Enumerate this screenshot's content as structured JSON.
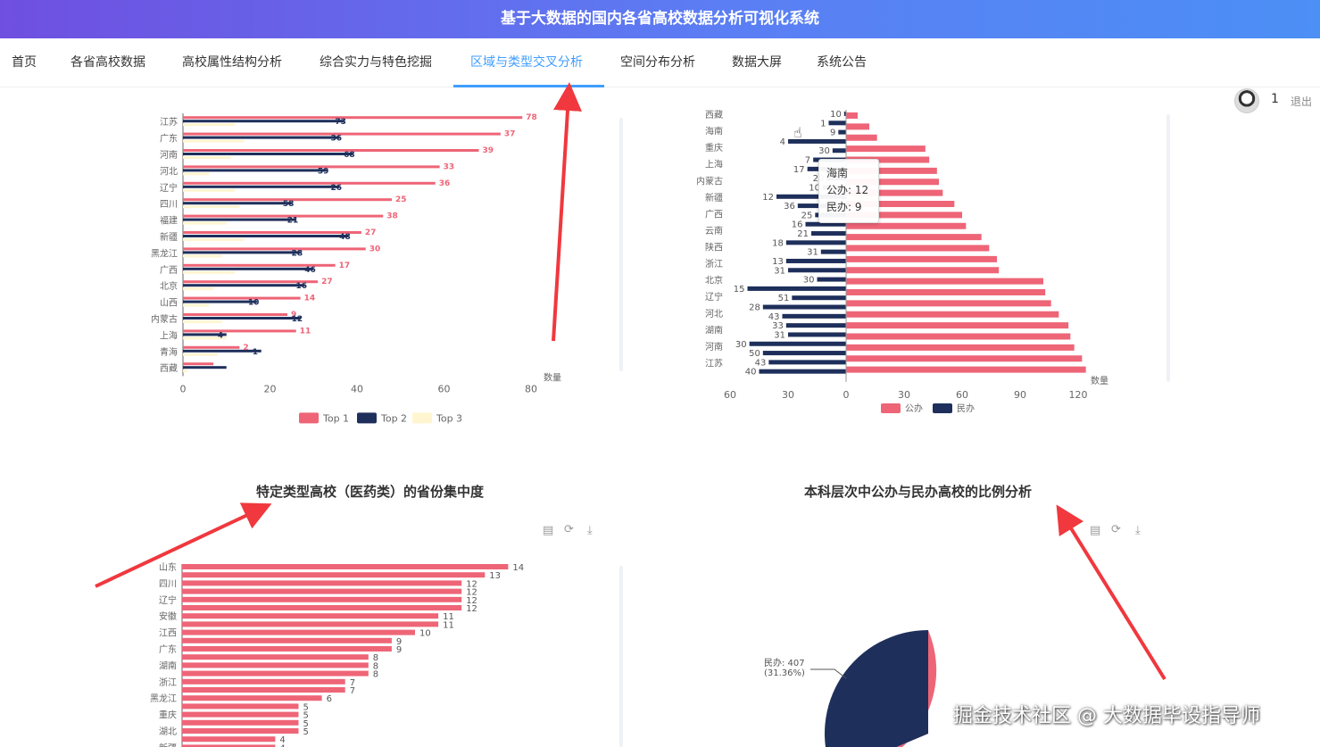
{
  "app": {
    "title": "基于大数据的国内各省高校数据分析可视化系统"
  },
  "nav": {
    "items": [
      "首页",
      "各省高校数据",
      "高校属性结构分析",
      "综合实力与特色挖掘",
      "区域与类型交叉分析",
      "空间分布分析",
      "数据大屏",
      "系统公告"
    ],
    "active_index": 4,
    "user_name": "1",
    "logout_label": "退出"
  },
  "panels": {
    "bottom_left_title": "特定类型高校（医药类）的省份集中度",
    "bottom_right_title": "本科层次中公办与民办高校的比例分析"
  },
  "tooltip": {
    "title": "海南",
    "line1": "公办: 12",
    "line2": "民办: 9"
  },
  "watermark": "掘金技术社区 @ 大数据毕设指导师",
  "colors": {
    "accent": "#409eff",
    "pink": "#ee6577",
    "navy": "#1e2f5b",
    "cream": "#fff5d0"
  },
  "chart_data": [
    {
      "type": "bar",
      "orientation": "horizontal",
      "categories": [
        "江苏",
        "广东",
        "河南",
        "河北",
        "辽宁",
        "四川",
        "福建",
        "新疆",
        "黑龙江",
        "广西",
        "北京",
        "山西",
        "内蒙古",
        "上海",
        "青海",
        "西藏"
      ],
      "series": [
        {
          "name": "Top 1",
          "values": [
            78,
            73,
            68,
            59,
            58,
            48,
            46,
            41,
            42,
            35,
            31,
            27,
            24,
            26,
            13,
            7
          ]
        },
        {
          "name": "Top 2",
          "values": [
            37,
            36,
            39,
            33,
            36,
            25,
            26,
            38,
            27,
            30,
            28,
            17,
            27,
            10,
            18,
            10
          ]
        },
        {
          "name": "Top 3",
          "values": [
            12,
            14,
            11,
            6,
            12,
            13,
            10,
            14,
            9,
            12,
            7,
            6,
            9,
            10,
            8,
            1
          ]
        }
      ],
      "value_labels": [
        "78",
        "73",
        "37",
        "36",
        "39",
        "68",
        "33",
        "59",
        "36",
        "26",
        "25",
        "58",
        "38",
        "21",
        "27",
        "48",
        "30",
        "28",
        "17",
        "46",
        "27",
        "16",
        "14",
        "10",
        "9",
        "12",
        "11",
        "4",
        "2",
        "1"
      ],
      "xlabel": "数量",
      "xticks": [
        "0",
        "20",
        "40",
        "60",
        "80"
      ],
      "xlim": [
        0,
        80
      ],
      "legend": [
        "Top 1",
        "Top 2",
        "Top 3"
      ],
      "legend_position": "bottom"
    },
    {
      "type": "bar",
      "orientation": "horizontal",
      "categories": [
        "西藏",
        "海南",
        "重庆",
        "上海",
        "内蒙古",
        "新疆",
        "广西",
        "云南",
        "陕西",
        "浙江",
        "北京",
        "辽宁",
        "河北",
        "湖南",
        "河南",
        "江苏"
      ],
      "series": [
        {
          "name": "公办",
          "values": [
            6,
            12,
            16,
            41,
            43,
            47,
            48,
            50,
            56,
            60,
            62,
            70,
            74,
            78,
            79,
            102,
            103,
            106,
            110,
            115,
            116,
            118,
            122,
            124
          ]
        },
        {
          "name": "民办",
          "values": [
            1,
            9,
            4,
            30,
            7,
            17,
            20,
            10,
            12,
            36,
            25,
            16,
            21,
            18,
            31,
            13,
            31,
            30,
            15,
            51,
            28,
            43,
            33,
            31,
            30,
            50,
            43,
            40,
            45
          ]
        }
      ],
      "series_value_labels": [
        "10",
        "1",
        "9",
        "4",
        "30",
        "7",
        "17",
        "20",
        "10",
        "12",
        "36",
        "25",
        "16",
        "21",
        "18",
        "31",
        "13",
        "31",
        "30",
        "15",
        "51",
        "28",
        "43",
        "33",
        "31",
        "30",
        "50",
        "43",
        "40",
        "45"
      ],
      "xlabel": "数量",
      "xticks": [
        "60",
        "30",
        "0",
        "30",
        "60",
        "90",
        "120"
      ],
      "xlim": [
        -60,
        120
      ],
      "legend": [
        "公办",
        "民办"
      ],
      "legend_position": "bottom"
    },
    {
      "type": "bar",
      "orientation": "horizontal",
      "title": "特定类型高校（医药类）的省份集中度",
      "categories": [
        "山东",
        "四川",
        "辽宁",
        "安徽",
        "江西",
        "广东",
        "湖南",
        "浙江",
        "黑龙江",
        "重庆",
        "湖北",
        "新疆"
      ],
      "values": [
        14,
        13,
        12,
        12,
        12,
        12,
        11,
        11,
        10,
        9,
        9,
        8,
        8,
        8,
        7,
        7,
        6,
        5,
        5,
        5,
        5,
        4,
        4
      ],
      "value_labels": [
        "14",
        "13",
        "12",
        "12",
        "12",
        "12",
        "11",
        "11",
        "10",
        "9",
        "9",
        "8",
        "8",
        "8",
        "7",
        "7",
        "6",
        "5",
        "5",
        "5",
        "5",
        "4",
        "4"
      ]
    },
    {
      "type": "pie",
      "title": "本科层次中公办与民办高校的比例分析",
      "slices": [
        {
          "label": "民办",
          "value": 407,
          "percent": 31.36
        },
        {
          "label": "公办",
          "value": 891,
          "percent": 68.64
        }
      ],
      "visible_label": "民办: 407\n(31.36%)"
    }
  ]
}
